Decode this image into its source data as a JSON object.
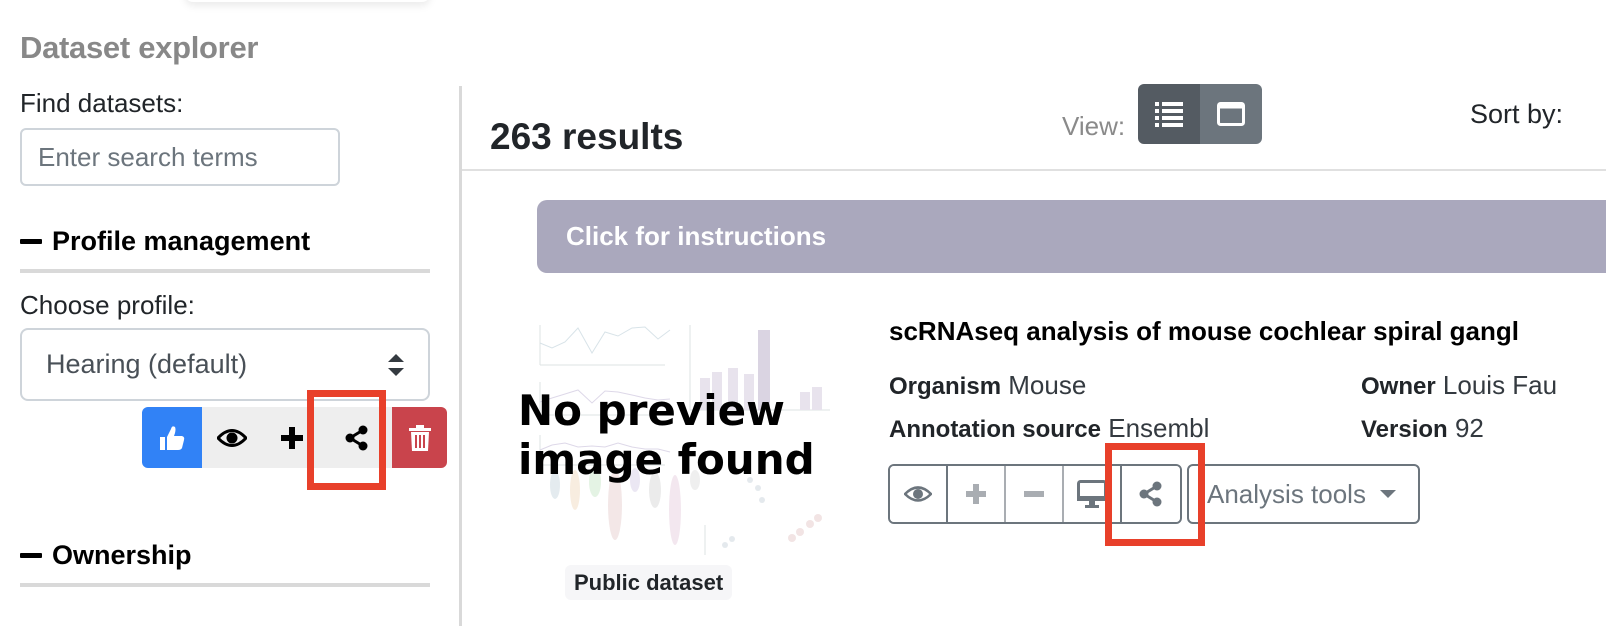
{
  "sidebar": {
    "title": "Dataset explorer",
    "find_label": "Find datasets:",
    "search_placeholder": "Enter search terms",
    "search_value": "",
    "profile_section": "Profile management",
    "choose_profile_label": "Choose profile:",
    "selected_profile": "Hearing (default)",
    "profile_actions": [
      {
        "icon": "thumbs-up-icon",
        "label": "Set as primary"
      },
      {
        "icon": "eye-icon",
        "label": "View"
      },
      {
        "icon": "plus-icon",
        "label": "Add"
      },
      {
        "icon": "share-icon",
        "label": "Share"
      },
      {
        "icon": "trash-icon",
        "label": "Delete"
      }
    ],
    "ownership_section": "Ownership"
  },
  "main": {
    "results_count": "263 results",
    "view_label": "View:",
    "view_modes": [
      {
        "icon": "list-icon",
        "active": true
      },
      {
        "icon": "window-icon",
        "active": false
      }
    ],
    "sort_label": "Sort by:",
    "instructions_label": "Click for instructions"
  },
  "dataset": {
    "preview_text_line1": "No preview",
    "preview_text_line2": "image found",
    "visibility_badge": "Public dataset",
    "title": "scRNAseq analysis of mouse cochlear spiral gangl",
    "organism_label": "Organism",
    "organism": "Mouse",
    "annotation_label": "Annotation source",
    "annotation": "Ensembl",
    "owner_label": "Owner",
    "owner": "Louis Fau",
    "version_label": "Version",
    "version": "92",
    "actions": [
      {
        "icon": "eye-icon"
      },
      {
        "icon": "plus-icon"
      },
      {
        "icon": "minus-icon"
      },
      {
        "icon": "desktop-icon"
      },
      {
        "icon": "share-icon"
      }
    ],
    "analysis_tools_label": "Analysis tools"
  },
  "colors": {
    "primary": "#3182f6",
    "danger": "#c9444c",
    "instructions_bg": "#aaa8bd",
    "highlight": "#e8402a",
    "toggle_active": "#545b62",
    "toggle_inactive": "#6c757d"
  }
}
